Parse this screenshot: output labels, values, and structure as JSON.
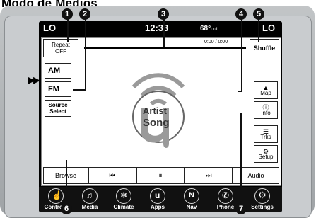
{
  "heading": "Modo de Medios",
  "status": {
    "left_label": "LO",
    "time": "12:33",
    "temp": "68°",
    "temp_unit": "out",
    "right_label": "LO"
  },
  "top": {
    "repeat_label_1": "Repeat",
    "repeat_label_2": "OFF",
    "track_time": "0:00 / 0:00",
    "shuffle_label": "Shuffle"
  },
  "sources": {
    "am": "AM",
    "fm": "FM",
    "source_select_1": "Source",
    "source_select_2": "Select",
    "active_marker": "▶▶"
  },
  "now_playing": {
    "artist": "Artist",
    "song": "Song"
  },
  "right": {
    "map": "Map",
    "info": "Info",
    "trks": "Trks",
    "setup": "Setup"
  },
  "bottom": {
    "browse": "Browse",
    "prev": "⏮",
    "pause": "⏸",
    "next": "⏭",
    "audio": "Audio"
  },
  "nav": [
    {
      "label": "Controls",
      "glyph": "☝"
    },
    {
      "label": "Media",
      "glyph": "♫"
    },
    {
      "label": "Climate",
      "glyph": "❄"
    },
    {
      "label": "Apps",
      "glyph": "u"
    },
    {
      "label": "Nav",
      "glyph": "N"
    },
    {
      "label": "Phone",
      "glyph": "✆"
    },
    {
      "label": "Settings",
      "glyph": "⚙"
    }
  ],
  "callouts": [
    "1",
    "2",
    "3",
    "4",
    "5",
    "6",
    "7"
  ]
}
